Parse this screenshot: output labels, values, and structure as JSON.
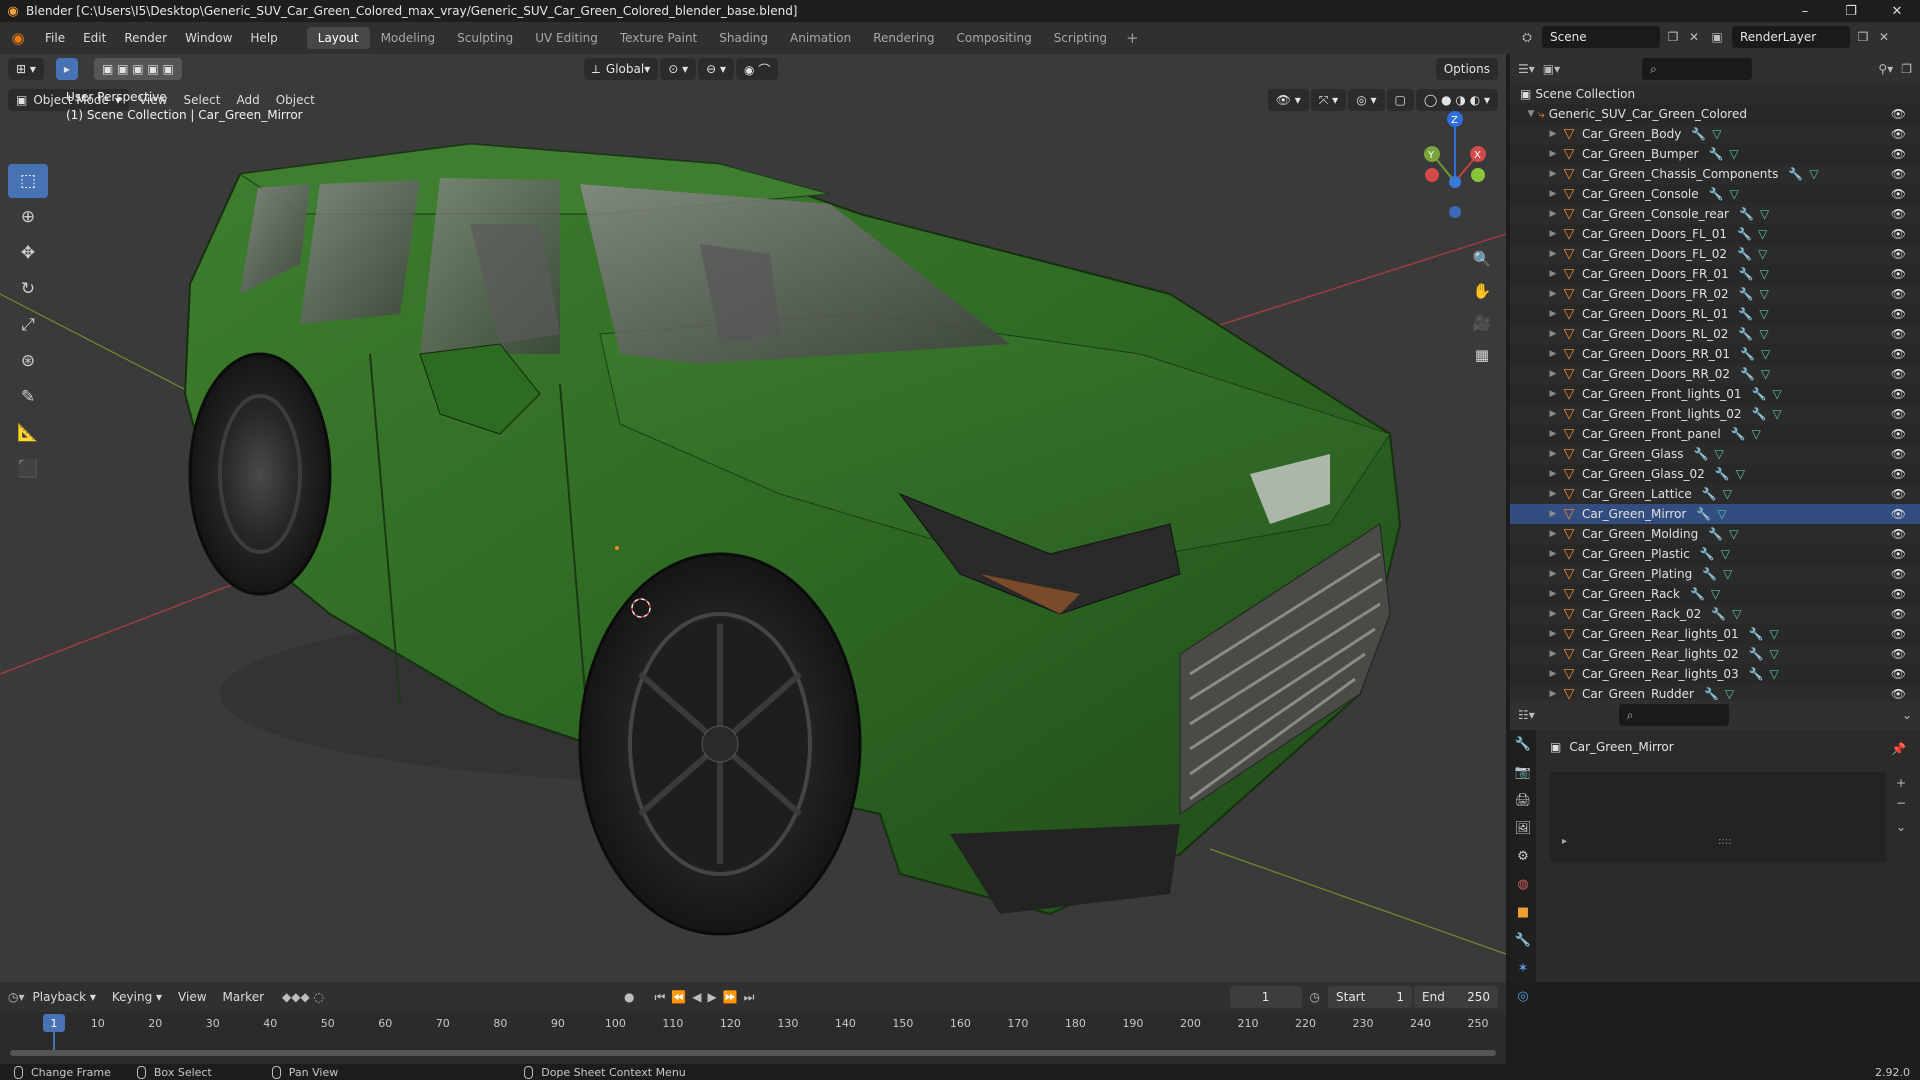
{
  "window": {
    "title": "Blender [C:\\Users\\I5\\Desktop\\Generic_SUV_Car_Green_Colored_max_vray/Generic_SUV_Car_Green_Colored_blender_base.blend]",
    "minimize": "–",
    "maximize": "❐",
    "close": "✕"
  },
  "menubar": {
    "items": [
      "File",
      "Edit",
      "Render",
      "Window",
      "Help"
    ],
    "workspaces": [
      "Layout",
      "Modeling",
      "Sculpting",
      "UV Editing",
      "Texture Paint",
      "Shading",
      "Animation",
      "Rendering",
      "Compositing",
      "Scripting"
    ],
    "active_workspace": "Layout",
    "add": "+",
    "scene": "Scene",
    "render_layer": "RenderLayer"
  },
  "viewport": {
    "mode": "Object Mode",
    "menus": [
      "View",
      "Select",
      "Add",
      "Object"
    ],
    "orientation": "Global",
    "options": "Options",
    "perspective": "User Perspective",
    "collection_path": "(1) Scene Collection | Car_Green_Mirror",
    "gizmo": {
      "x": "X",
      "y": "Y",
      "z": "Z"
    },
    "colors": {
      "background": "#3a3a3a",
      "car_body": "#2f6a24",
      "x_axis": "#b23a3a",
      "y_axis": "#6f8c32",
      "active": "#4772b3"
    }
  },
  "tools": [
    "select-box",
    "cursor",
    "move",
    "rotate",
    "scale",
    "transform",
    "annotate",
    "measure",
    "add-cube"
  ],
  "outliner": {
    "root": "Scene Collection",
    "collection": "Generic_SUV_Car_Green_Colored",
    "items": [
      "Car_Green_Body",
      "Car_Green_Bumper",
      "Car_Green_Chassis_Components",
      "Car_Green_Console",
      "Car_Green_Console_rear",
      "Car_Green_Doors_FL_01",
      "Car_Green_Doors_FL_02",
      "Car_Green_Doors_FR_01",
      "Car_Green_Doors_FR_02",
      "Car_Green_Doors_RL_01",
      "Car_Green_Doors_RL_02",
      "Car_Green_Doors_RR_01",
      "Car_Green_Doors_RR_02",
      "Car_Green_Front_lights_01",
      "Car_Green_Front_lights_02",
      "Car_Green_Front_panel",
      "Car_Green_Glass",
      "Car_Green_Glass_02",
      "Car_Green_Lattice",
      "Car_Green_Mirror",
      "Car_Green_Molding",
      "Car_Green_Plastic",
      "Car_Green_Plating",
      "Car_Green_Rack",
      "Car_Green_Rack_02",
      "Car_Green_Rear_lights_01",
      "Car_Green_Rear_lights_02",
      "Car_Green_Rear_lights_03",
      "Car_Green_Rudder"
    ],
    "selected": "Car_Green_Mirror"
  },
  "properties": {
    "object_name": "Car_Green_Mirror",
    "expand": "▸",
    "dots": "::::"
  },
  "timeline": {
    "menus": [
      "Playback",
      "Keying",
      "View",
      "Marker"
    ],
    "current_frame": "1",
    "start_label": "Start",
    "start": "1",
    "end_label": "End",
    "end": "250",
    "ticks": [
      "1",
      "10",
      "20",
      "30",
      "40",
      "50",
      "60",
      "70",
      "80",
      "90",
      "100",
      "110",
      "120",
      "130",
      "140",
      "150",
      "160",
      "170",
      "180",
      "190",
      "200",
      "210",
      "220",
      "230",
      "240",
      "250"
    ]
  },
  "statusbar": {
    "items": [
      "Change Frame",
      "Box Select",
      "Pan View",
      "Dope Sheet Context Menu"
    ],
    "version": "2.92.0"
  }
}
